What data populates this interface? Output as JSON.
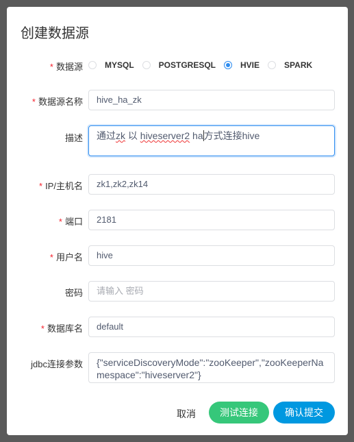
{
  "dialog": {
    "title": "创建数据源"
  },
  "form": {
    "source": {
      "label": "数据源",
      "options": [
        "MYSQL",
        "POSTGRESQL",
        "HVIE",
        "SPARK"
      ],
      "selected": "HVIE"
    },
    "name": {
      "label": "数据源名称",
      "value": "hive_ha_zk"
    },
    "desc": {
      "label": "描述",
      "value_parts": [
        "通过",
        "zk",
        " 以 ",
        "hiveserver2",
        " ha",
        "方式连接hive"
      ]
    },
    "ip": {
      "label": "IP/主机名",
      "value": "zk1,zk2,zk14"
    },
    "port": {
      "label": "端口",
      "value": "2181"
    },
    "user": {
      "label": "用户名",
      "value": "hive"
    },
    "password": {
      "label": "密码",
      "placeholder": "请输入 密码"
    },
    "db": {
      "label": "数据库名",
      "value": "default"
    },
    "jdbc": {
      "label": "jdbc连接参数",
      "value": "{\"serviceDiscoveryMode\":\"zooKeeper\",\"zooKeeperNamespace\":\"hiveserver2\"}"
    }
  },
  "buttons": {
    "cancel": "取消",
    "test": "测试连接",
    "submit": "确认提交"
  },
  "colors": {
    "test": "#36c77a",
    "submit": "#0098e0",
    "focus": "#2d8cf0",
    "required": "#f5222d"
  }
}
